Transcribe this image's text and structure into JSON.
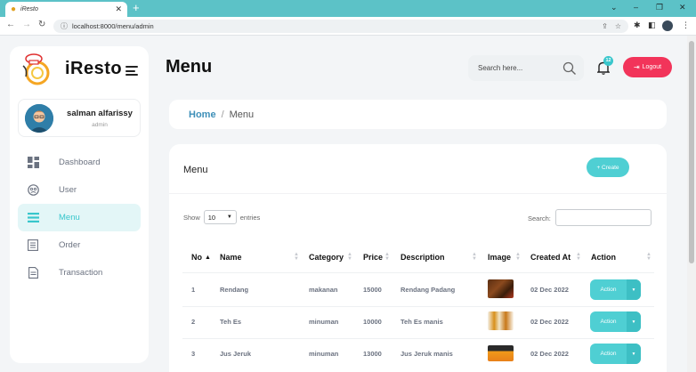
{
  "browser": {
    "tab_title": "iResto",
    "url": "localhost:8000/menu/admin"
  },
  "sidebar": {
    "brand": "iResto",
    "user": {
      "name": "salman alfarissy",
      "role": "admin"
    },
    "items": [
      {
        "label": "Dashboard",
        "icon": "dashboard-icon",
        "active": false
      },
      {
        "label": "User",
        "icon": "user-icon",
        "active": false
      },
      {
        "label": "Menu",
        "icon": "menu-icon",
        "active": true
      },
      {
        "label": "Order",
        "icon": "order-icon",
        "active": false
      },
      {
        "label": "Transaction",
        "icon": "transaction-icon",
        "active": false
      }
    ]
  },
  "header": {
    "title": "Menu",
    "search_placeholder": "Search here...",
    "notification_count": "12",
    "logout_label": "Logout"
  },
  "breadcrumb": {
    "home": "Home",
    "separator": "/",
    "current": "Menu"
  },
  "card": {
    "title": "Menu",
    "create_label": "+ Create",
    "show_label": "Show",
    "entries_value": "10",
    "entries_label": "entries",
    "search_label": "Search:"
  },
  "table": {
    "columns": [
      "No",
      "Name",
      "Category",
      "Price",
      "Description",
      "Image",
      "Created At",
      "Action"
    ],
    "rows": [
      {
        "no": "1",
        "name": "Rendang",
        "category": "makanan",
        "price": "15000",
        "description": "Rendang Padang",
        "image": "rendang-photo",
        "created_at": "02 Dec 2022",
        "action": "Action"
      },
      {
        "no": "2",
        "name": "Teh Es",
        "category": "minuman",
        "price": "10000",
        "description": "Teh Es manis",
        "image": "teh-es-photo",
        "created_at": "02 Dec 2022",
        "action": "Action"
      },
      {
        "no": "3",
        "name": "Jus Jeruk",
        "category": "minuman",
        "price": "13000",
        "description": "Jus Jeruk manis",
        "image": "jus-jeruk-photo",
        "created_at": "02 Dec 2022",
        "action": "Action"
      }
    ]
  },
  "colors": {
    "accent": "#4fcfd3",
    "logout": "#f2345a",
    "link": "#3d8fb8",
    "chrome": "#5cc2c7"
  }
}
